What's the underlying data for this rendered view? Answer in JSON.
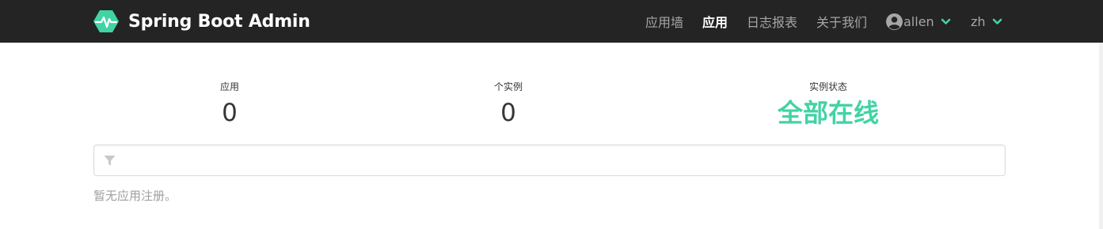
{
  "app": {
    "title": "Spring Boot Admin",
    "logo_icon": "heartbeat-hexagon-icon",
    "brand_color": "#42d3a5",
    "navbar_color": "#242424"
  },
  "nav": {
    "items": [
      {
        "label": "应用墙",
        "active": false
      },
      {
        "label": "应用",
        "active": true
      },
      {
        "label": "日志报表",
        "active": false
      },
      {
        "label": "关于我们",
        "active": false
      }
    ],
    "user": {
      "name": "allen",
      "icon": "user-circle-icon"
    },
    "language": {
      "value": "zh",
      "icon": "chevron-down-icon"
    }
  },
  "summary": {
    "applications": {
      "label": "应用",
      "value": "0"
    },
    "instances": {
      "label": "个实例",
      "value": "0"
    },
    "status": {
      "label": "实例状态",
      "value": "全部在线",
      "color": "#42d3a5"
    }
  },
  "filter": {
    "icon": "filter-icon",
    "value": "",
    "placeholder": ""
  },
  "empty_message": "暂无应用注册。"
}
